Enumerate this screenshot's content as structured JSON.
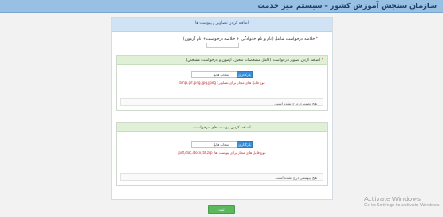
{
  "header": {
    "title": "سازمان سنجش آموزش کشور - سیستم میز خدمت"
  },
  "panel": {
    "title": "اضافه کردن تصاویر و پیوست ها",
    "request_summary_label": "خلاصه درخواست شامل (نام و نام خانوادگی + خلاصه درخواست+ نام آزمون)",
    "request_summary_value": ""
  },
  "image_section": {
    "title": "اضافه کردن تصویر درخواست (کامل مشخصات محرز، آزمون و درخواست مشخص)",
    "choose_label": "انتخاب فایل",
    "browse_label": "بارگذاری",
    "allowed_types": "نوع فایل های مجاز برای تصاویر: bmp,gif,png,jpg,jpeg",
    "status": "هیچ تصویری درج نشده است."
  },
  "attachment_section": {
    "title": "اضافه کردن پیوست های درخواست",
    "choose_label": "انتخاب فایل",
    "browse_label": "بارگذاری",
    "allowed_types": "نوع فایل های مجاز برای پیوست ها: pdf,doc,docx,tif,zip",
    "status": "هیچ پیوستی درج نشده است."
  },
  "actions": {
    "submit_label": "ثبت"
  },
  "os_watermark": {
    "line1": "Activate Windows",
    "line2": "Go to Settings to activate Windows."
  },
  "colors": {
    "topbar": "#97c0e3",
    "panel_header": "#cfe3f5",
    "section_header": "#dff0d6",
    "browse_button": "#3b8ed8",
    "submit_button": "#5cb85c",
    "hint_text": "#c0272d"
  }
}
